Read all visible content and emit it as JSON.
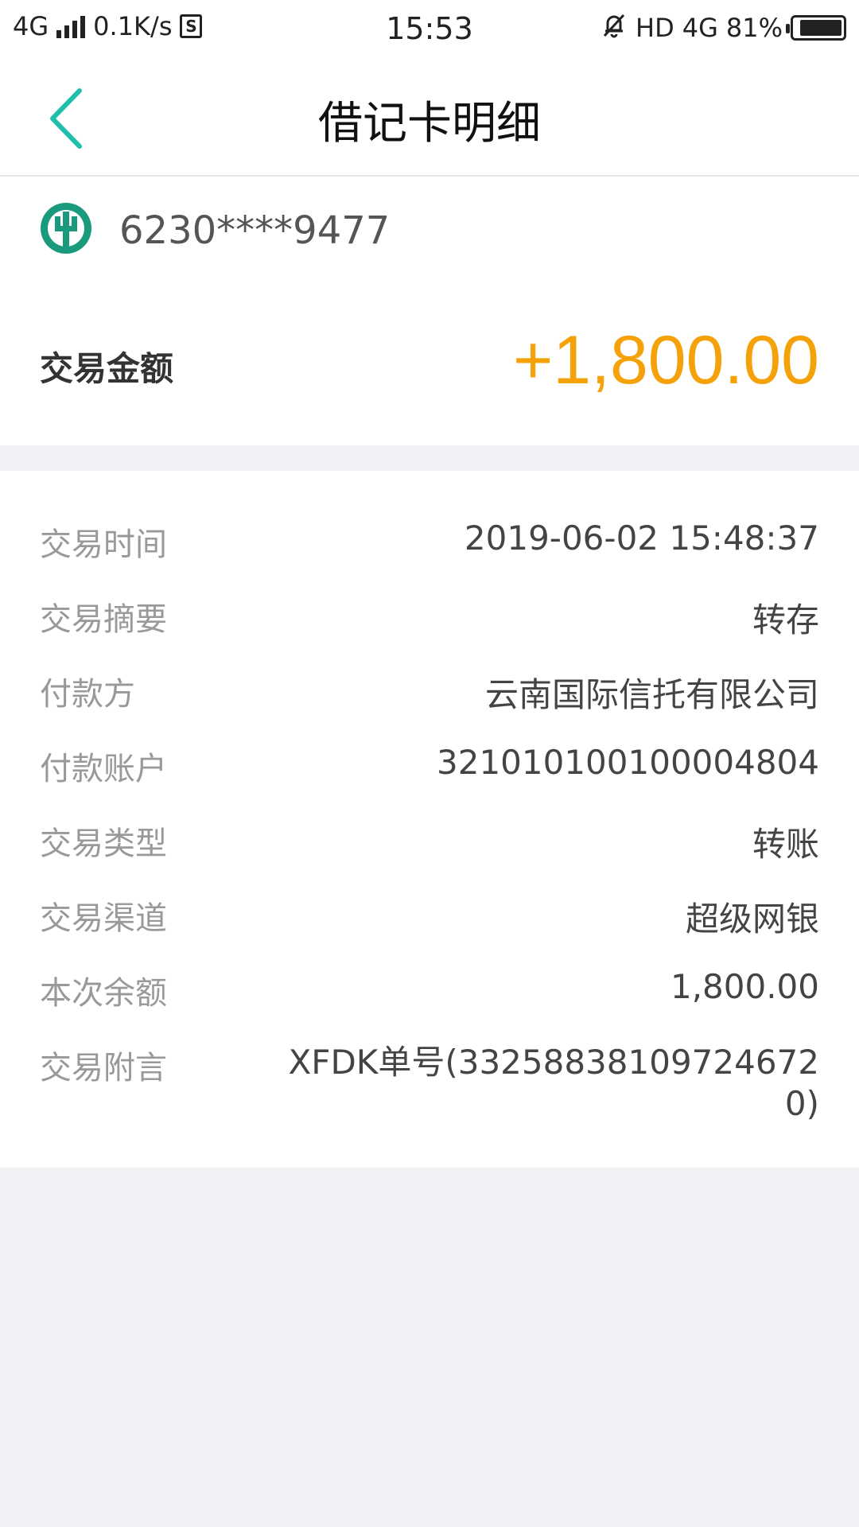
{
  "status_bar": {
    "network": "4G",
    "speed": "0.1K/s",
    "sd_label": "S",
    "time": "15:53",
    "hd": "HD",
    "network_right": "4G",
    "battery": "81%"
  },
  "nav": {
    "title": "借记卡明细"
  },
  "card": {
    "number": "6230****9477",
    "amount_label": "交易金额",
    "amount_value": "+1,800.00"
  },
  "details": [
    {
      "label": "交易时间",
      "value": "2019-06-02 15:48:37"
    },
    {
      "label": "交易摘要",
      "value": "转存"
    },
    {
      "label": "付款方",
      "value": "云南国际信托有限公司"
    },
    {
      "label": "付款账户",
      "value": "321010100100004804"
    },
    {
      "label": "交易类型",
      "value": "转账"
    },
    {
      "label": "交易渠道",
      "value": "超级网银"
    },
    {
      "label": "本次余额",
      "value": "1,800.00"
    },
    {
      "label": "交易附言",
      "value": "XFDK单号(332588381097246720)"
    }
  ],
  "colors": {
    "accent_teal": "#1fbfae",
    "amount_orange": "#f5a20a",
    "bank_green": "#1a9a7c"
  }
}
